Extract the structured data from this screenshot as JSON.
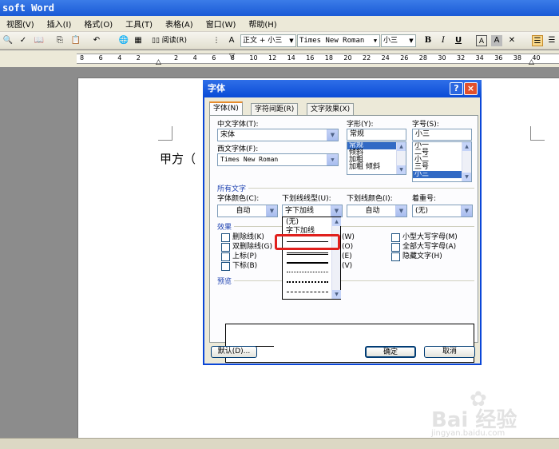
{
  "window": {
    "title": "soft Word"
  },
  "menu": [
    "视图(V)",
    "插入(I)",
    "格式(O)",
    "工具(T)",
    "表格(A)",
    "窗口(W)",
    "帮助(H)"
  ],
  "toolbar": {
    "read_label": "阅读(R)",
    "style": "正文 + 小三",
    "font": "Times New Roman",
    "size": "小三",
    "bold": "B",
    "italic": "I",
    "underline": "U",
    "fontcolor": "A"
  },
  "ruler": {
    "labels": [
      "8",
      "6",
      "4",
      "2",
      "",
      "2",
      "4",
      "6",
      "8",
      "10",
      "12",
      "14",
      "16",
      "18",
      "20",
      "22",
      "24",
      "26",
      "28",
      "30",
      "32",
      "34",
      "36",
      "38",
      "40"
    ]
  },
  "document": {
    "text": "甲方（"
  },
  "dialog": {
    "title": "字体",
    "help": "?",
    "close": "×",
    "tabs": [
      "字体(N)",
      "字符间距(R)",
      "文字效果(X)"
    ],
    "cn_font_label": "中文字体(T):",
    "cn_font_value": "宋体",
    "west_font_label": "西文字体(F):",
    "west_font_value": "Times New Roman",
    "style_label": "字形(Y):",
    "style_value": "常规",
    "style_items": [
      "常规",
      "倾斜",
      "加粗",
      "加粗 倾斜"
    ],
    "size_label": "字号(S):",
    "size_value": "小三",
    "size_items": [
      "小一",
      "二号",
      "小二",
      "三号",
      "小三"
    ],
    "all_text": "所有文字",
    "color_label": "字体颜色(C):",
    "color_value": "自动",
    "underline_label": "下划线线型(U):",
    "underline_value": "字下加线",
    "ucolor_label": "下划线颜色(I):",
    "ucolor_value": "自动",
    "emphasis_label": "着重号:",
    "emphasis_value": "(无)",
    "effects": "效果",
    "effects_left": [
      "删除线(K)",
      "双删除线(G)",
      "上标(P)",
      "下标(B)"
    ],
    "effects_mid_suffix": [
      "(W)",
      "(O)",
      "(E)",
      "(V)"
    ],
    "effects_right": [
      "小型大写字母(M)",
      "全部大写字母(A)",
      "隐藏文字(H)"
    ],
    "preview": "预览",
    "dropdown_items": [
      "(无)",
      "字下加线"
    ],
    "default_button": "默认(D)...",
    "ok_button": "确定",
    "cancel_button": "取消"
  },
  "watermark": {
    "text": "Bai 经验",
    "sub": "jingyan.baidu.com"
  }
}
